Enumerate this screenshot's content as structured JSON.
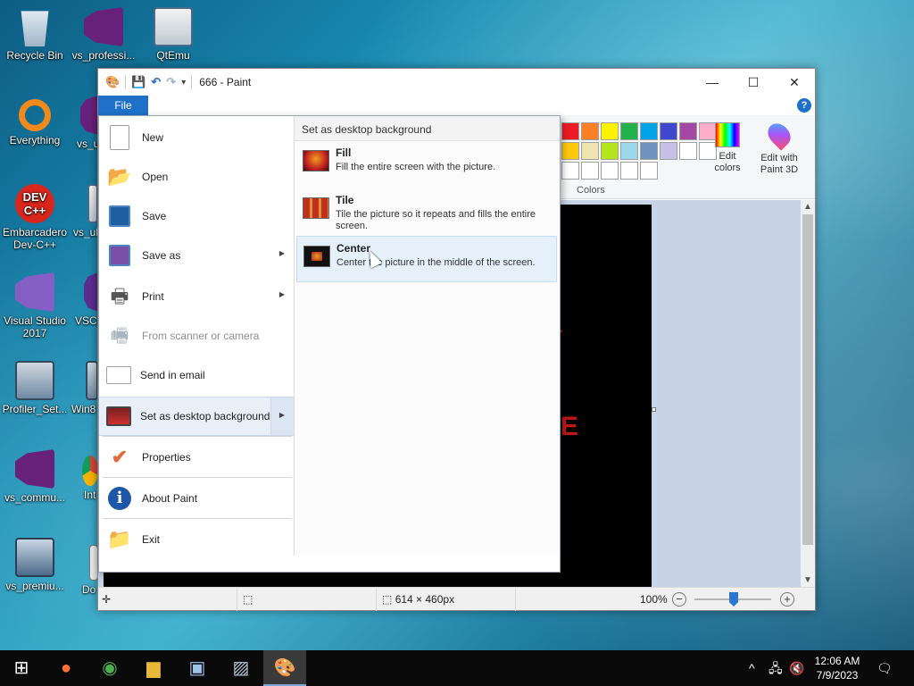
{
  "desktop": {
    "icons": [
      {
        "label": "Recycle Bin",
        "icon": "recycle-bin-icon"
      },
      {
        "label": "vs_professi...",
        "icon": "visual-studio-icon"
      },
      {
        "label": "QtEmu",
        "icon": "qtemu-icon"
      },
      {
        "label": "Everything",
        "icon": "everything-search-icon"
      },
      {
        "label": "vs_u",
        "icon": "visual-studio-icon"
      },
      {
        "label": "Embarcadero Dev-C++",
        "icon": "devcpp-icon"
      },
      {
        "label": "vs_ul",
        "icon": "installer-icon"
      },
      {
        "label": "Visual Studio 2017",
        "icon": "visual-studio-2017-icon"
      },
      {
        "label": "VSCo",
        "icon": "vscode-icon"
      },
      {
        "label": "Profiler_Set...",
        "icon": "profiler-setup-icon"
      },
      {
        "label": "Win8",
        "icon": "installer-icon"
      },
      {
        "label": "vs_commu...",
        "icon": "visual-studio-icon"
      },
      {
        "label": "Int Do",
        "icon": "chrome-shortcut-icon"
      },
      {
        "label": "vs_premiu...",
        "icon": "vs-premium-icon"
      },
      {
        "label": "Do",
        "icon": "document-icon"
      }
    ]
  },
  "paint": {
    "title": "666 - Paint",
    "file_tab": "File",
    "help": "?",
    "colors_label": "Colors",
    "edit_colors": "Edit colors",
    "edit_paint3d": "Edit with Paint 3D",
    "palette": [
      "#ed1c24",
      "#ff7f27",
      "#fff200",
      "#22b14c",
      "#00a2e8",
      "#3f48cc",
      "#a349a4",
      "#ffaec9",
      "#ffc90e",
      "#efe4b0",
      "#b5e61d",
      "#99d9ea",
      "#7092be",
      "#c8bfe7",
      "#ffffff",
      "#ffffff",
      "#ffffff",
      "#ffffff",
      "#ffffff",
      "#ffffff",
      "#ffffff"
    ],
    "canvas_text_1": "-",
    "canvas_text_2": "E",
    "status": {
      "size": "614 × 460px",
      "zoom": "100%"
    }
  },
  "file_menu": {
    "items": [
      {
        "label": "New",
        "icon": "new-document-icon"
      },
      {
        "label": "Open",
        "icon": "open-folder-icon"
      },
      {
        "label": "Save",
        "icon": "save-disk-icon"
      },
      {
        "label": "Save as",
        "icon": "save-as-icon"
      },
      {
        "label": "Print",
        "icon": "printer-icon"
      },
      {
        "label": "From scanner or camera",
        "icon": "scanner-icon"
      },
      {
        "label": "Send in email",
        "icon": "email-icon"
      },
      {
        "label": "Set as desktop background",
        "icon": "desktop-background-icon"
      },
      {
        "label": "Properties",
        "icon": "checkmark-icon"
      },
      {
        "label": "About Paint",
        "icon": "info-icon"
      },
      {
        "label": "Exit",
        "icon": "exit-icon"
      }
    ],
    "submenu": {
      "title": "Set as desktop background",
      "options": [
        {
          "title": "Fill",
          "desc": "Fill the entire screen with the picture."
        },
        {
          "title": "Tile",
          "desc": "Tile the picture so it repeats and fills the entire screen."
        },
        {
          "title": "Center",
          "desc": "Center the picture in the middle of the screen."
        }
      ]
    }
  },
  "taskbar": {
    "time": "12:06 AM",
    "date": "7/9/2023"
  }
}
